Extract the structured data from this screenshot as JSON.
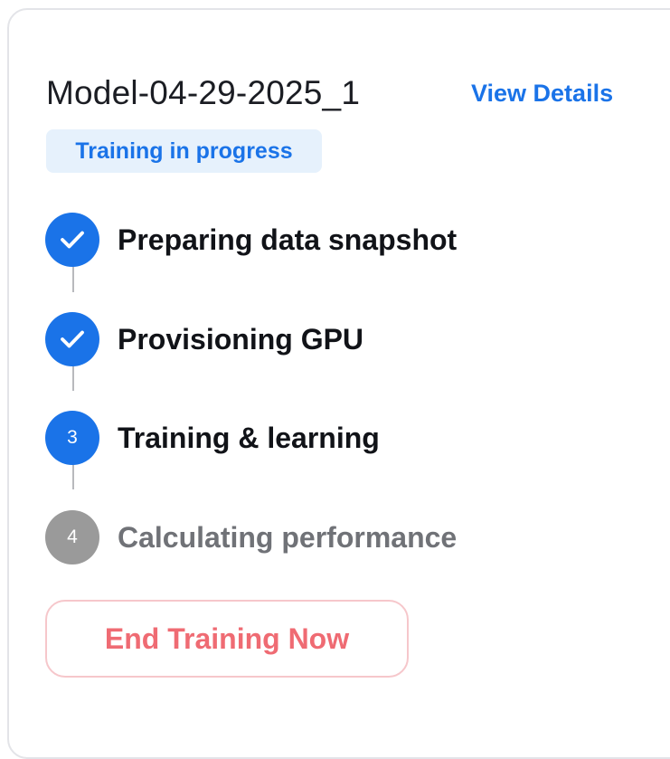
{
  "model": {
    "title": "Model-04-29-2025_1",
    "view_details_label": "View Details",
    "status_badge": "Training in progress"
  },
  "steps": [
    {
      "label": "Preparing data snapshot",
      "state": "completed",
      "marker": "check-icon"
    },
    {
      "label": "Provisioning GPU",
      "state": "completed",
      "marker": "check-icon"
    },
    {
      "label": "Training & learning",
      "state": "active",
      "number": "3"
    },
    {
      "label": "Calculating performance",
      "state": "pending",
      "number": "4"
    }
  ],
  "actions": {
    "end_training_label": "End Training Now"
  },
  "colors": {
    "accent": "#1a73e8",
    "badge_background": "#e6f1fc",
    "pending": "#9a9a9a",
    "danger": "#ef6b73",
    "danger_border": "#f6c7cb"
  }
}
